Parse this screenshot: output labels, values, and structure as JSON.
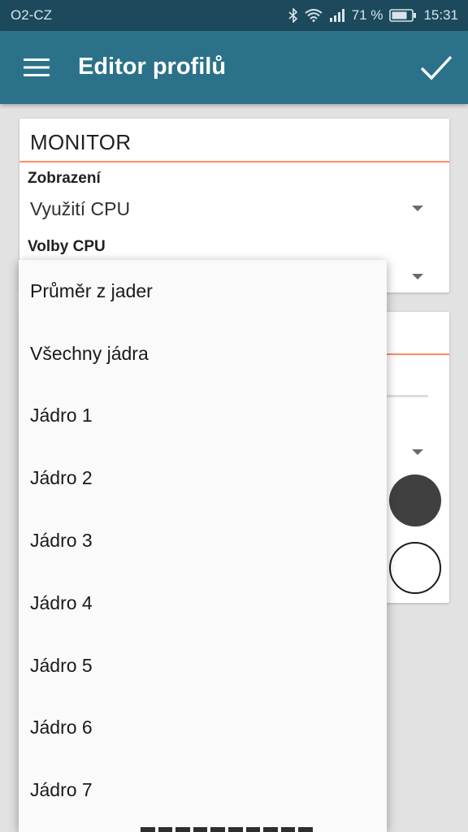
{
  "status_bar": {
    "carrier": "O2-CZ",
    "battery_percent": "71 %",
    "time": "15:31",
    "icons": [
      "bluetooth-icon",
      "wifi-icon",
      "signal-icon",
      "battery-icon"
    ]
  },
  "app_bar": {
    "title": "Editor profilů",
    "menu_icon": "hamburger-menu-icon",
    "confirm_icon": "check-icon",
    "background": "#2b7189"
  },
  "monitor_card": {
    "header": "MONITOR",
    "display_label": "Zobrazení",
    "display_value": "Využití CPU",
    "cpu_options_label": "Volby CPU"
  },
  "second_card": {
    "color_dark": "#404040",
    "color_light": "#ffffff"
  },
  "dropdown": {
    "items": [
      "Průměr z jader",
      "Všechny jádra",
      "Jádro 1",
      "Jádro 2",
      "Jádro 3",
      "Jádro 4",
      "Jádro 5",
      "Jádro 6",
      "Jádro 7"
    ]
  },
  "colors": {
    "accent": "#ff8a65",
    "status_bar": "#1c4a5c"
  }
}
